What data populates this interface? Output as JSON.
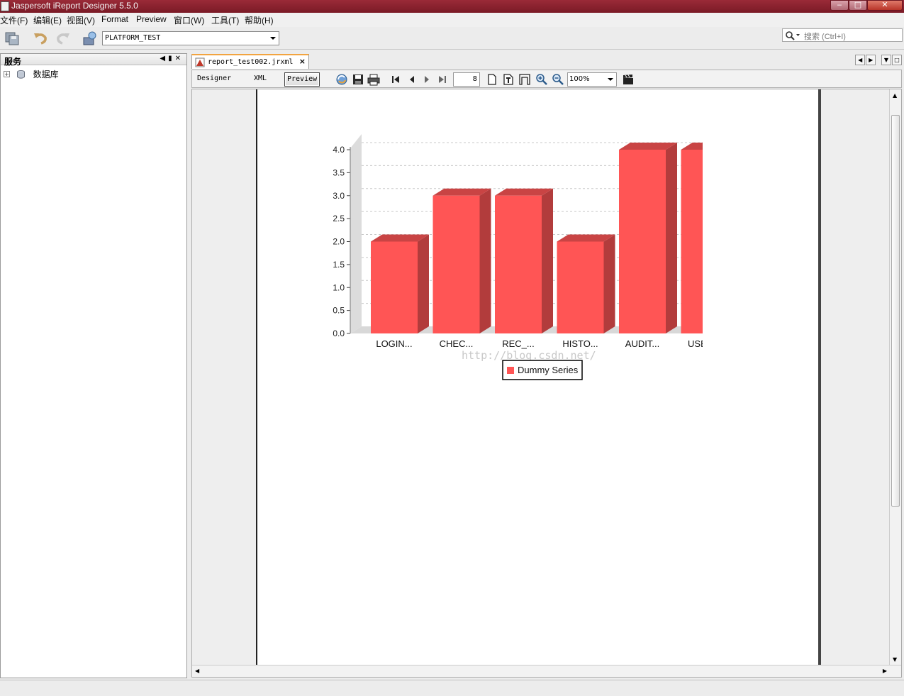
{
  "window": {
    "title": "Jaspersoft iReport Designer 5.5.0",
    "minimize": "‒",
    "maximize": "□",
    "close": "✕"
  },
  "menu": [
    {
      "label": "文件(F)"
    },
    {
      "label": "编辑(E)"
    },
    {
      "label": "视图(V)"
    },
    {
      "label": "Format"
    },
    {
      "label": "Preview"
    },
    {
      "label": "窗口(W)"
    },
    {
      "label": "工具(T)"
    },
    {
      "label": "帮助(H)"
    }
  ],
  "toolbar": {
    "datasource": "PLATFORM_TEST",
    "search_placeholder": "搜索 (Ctrl+I)"
  },
  "services_panel": {
    "title": "服务",
    "tree": [
      {
        "label": "数据库",
        "expander": "+"
      }
    ]
  },
  "editor": {
    "tab_label": "report_test002.jrxml",
    "tab_close": "×",
    "modes": {
      "designer": "Designer",
      "xml": "XML",
      "preview": "Preview"
    },
    "page_number": "8",
    "zoom": "100%"
  },
  "colors": {
    "bar_front": "#ff5555",
    "bar_side": "#b23c3c",
    "bar_top": "#c94444",
    "title_bar": "#8a1f2e",
    "tab_accent": "#f2a440"
  },
  "chart_data": {
    "type": "bar",
    "categories": [
      "LOGIN...",
      "CHEC...",
      "REC_...",
      "HISTO...",
      "AUDIT...",
      "USER..."
    ],
    "series": [
      {
        "name": "Dummy Series",
        "values": [
          2,
          3,
          3,
          2,
          4,
          4
        ]
      }
    ],
    "ylim": [
      0,
      4
    ],
    "yticks": [
      "0.0",
      "0.5",
      "1.0",
      "1.5",
      "2.0",
      "2.5",
      "3.0",
      "3.5",
      "4.0"
    ],
    "grid": true,
    "legend": "bottom-center",
    "three_d": true,
    "watermark": "http://blog.csdn.net/"
  }
}
